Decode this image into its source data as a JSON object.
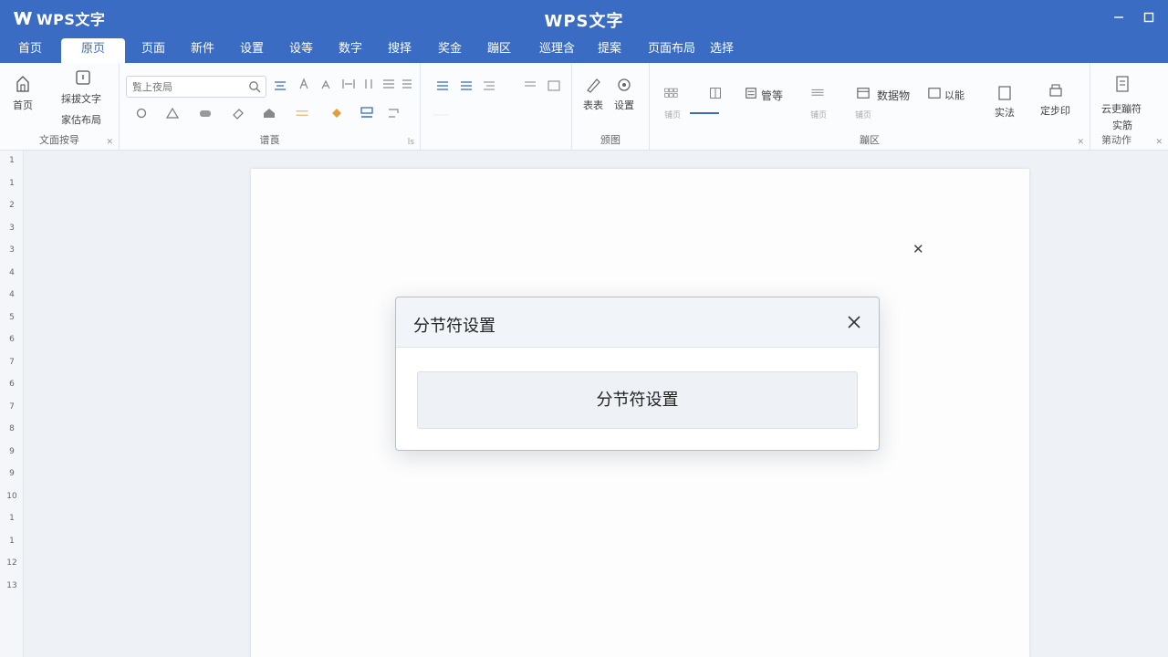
{
  "app": {
    "logo_text": "WPS文字",
    "title": "WPS文字"
  },
  "tabs": [
    {
      "label": "首页"
    },
    {
      "label": "原页"
    },
    {
      "label": "页面"
    },
    {
      "label": "新件"
    },
    {
      "label": "设置"
    },
    {
      "label": "设等"
    },
    {
      "label": "数字"
    },
    {
      "label": "搜择"
    },
    {
      "label": "奖金"
    },
    {
      "label": "蹦区"
    },
    {
      "label": "巡理含"
    },
    {
      "label": "提案"
    },
    {
      "label": "页面布局"
    },
    {
      "label": "选择"
    }
  ],
  "ribbon": {
    "group1": {
      "label": "文面按导",
      "home_label": "首页",
      "text_label": "採拔文字",
      "layout_label": "家估布局"
    },
    "group2": {
      "label": "谱莨",
      "search_placeholder": "覧上夜局",
      "corner": "ls"
    },
    "group4": {
      "label": "颁图",
      "attr_label": "表表",
      "settings_label": "设置"
    },
    "group5": {
      "label": "蹦区",
      "format_label": "管等",
      "data_label": "数据物",
      "extra_label": "以能",
      "sub1": "铺页",
      "sub2": "铺页",
      "sub3": "铺页",
      "style_label": "实法",
      "print_label": "定步印"
    },
    "group6": {
      "label": "第动作",
      "line1": "云吏蹦符",
      "line2": "实筋"
    }
  },
  "ruler_numbers": [
    "1",
    "1",
    "2",
    "3",
    "3",
    "4",
    "4",
    "5",
    "6",
    "7",
    "6",
    "7",
    "8",
    "9",
    "9",
    "10",
    "1",
    "1",
    "12",
    "13"
  ],
  "dialog": {
    "title": "分节符设置",
    "button_label": "分节符设置"
  }
}
